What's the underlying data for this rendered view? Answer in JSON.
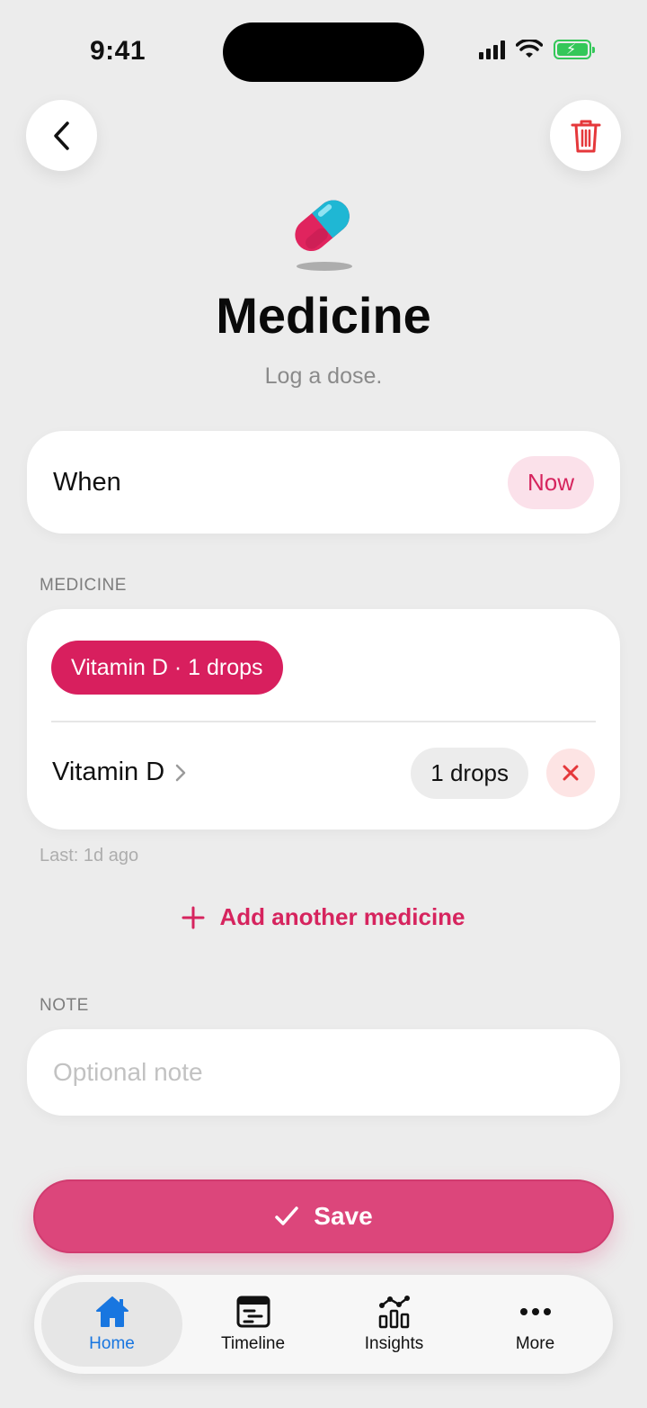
{
  "status_bar": {
    "time": "9:41"
  },
  "header": {
    "back_icon": "chevron-left-icon",
    "delete_icon": "trash-icon",
    "emoji_icon": "pill-icon",
    "title": "Medicine",
    "subtitle": "Log a dose."
  },
  "when": {
    "label": "When",
    "value": "Now"
  },
  "medicine_section": {
    "label": "MEDICINE",
    "selected_chip": "Vitamin D · 1 drops",
    "item": {
      "name": "Vitamin D",
      "dose": "1 drops"
    },
    "last": "Last: 1d ago",
    "add_label": "Add another medicine"
  },
  "note_section": {
    "label": "NOTE",
    "placeholder": "Optional note"
  },
  "save": {
    "label": "Save"
  },
  "tabs": [
    {
      "label": "Home",
      "icon": "home-icon",
      "active": true
    },
    {
      "label": "Timeline",
      "icon": "timeline-icon",
      "active": false
    },
    {
      "label": "Insights",
      "icon": "insights-icon",
      "active": false
    },
    {
      "label": "More",
      "icon": "more-icon",
      "active": false
    }
  ],
  "colors": {
    "accent": "#d81f5e",
    "save": "#dc467b",
    "active_tab": "#1876e0",
    "destructive": "#e5383b"
  }
}
